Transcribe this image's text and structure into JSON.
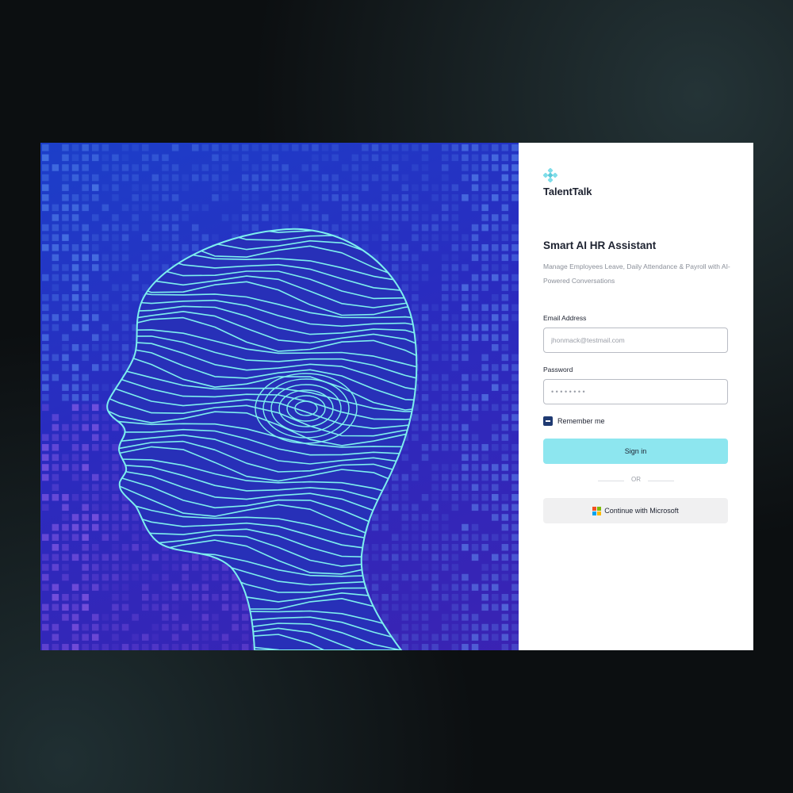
{
  "app": {
    "brand_name": "TalentTalk",
    "logo_icon": "diamond-cluster-icon",
    "accent_color": "#8de6ef"
  },
  "hero": {
    "illustration": "ai-head-line-art",
    "background_colors": [
      "#1c3fc9",
      "#3a23b3"
    ],
    "line_color": "#7df0ee"
  },
  "login": {
    "title": "Smart AI HR Assistant",
    "subtitle": "Manage Employees Leave, Daily Attendance & Payroll with AI-Powered Conversations",
    "email": {
      "label": "Email Address",
      "placeholder": "jhonmack@testmail.com",
      "value": ""
    },
    "password": {
      "label": "Password",
      "value": "••••••••"
    },
    "remember_me": {
      "label": "Remember me",
      "checked": true
    },
    "sign_in_label": "Sign in",
    "divider_text": "OR",
    "microsoft": {
      "label": "Continue with Microsoft",
      "icon": "microsoft-logo-icon",
      "colors": [
        "#f25022",
        "#7fba00",
        "#00a4ef",
        "#ffb900"
      ]
    }
  }
}
